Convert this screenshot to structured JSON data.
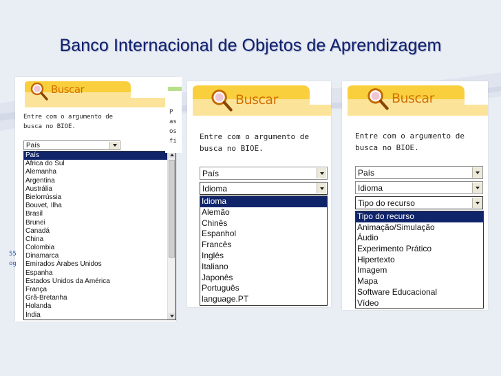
{
  "slide": {
    "title": "Banco Internacional de Objetos de Aprendizagem"
  },
  "colors": {
    "title": "#10206e",
    "buscar": "#d26f00",
    "header_bar": "#f9cf3e",
    "selected": "#10246a"
  },
  "panel1": {
    "buscar": "Buscar",
    "instruction": [
      "Entre com o argumento de",
      "busca no BIOE."
    ],
    "select_value": "País",
    "options": [
      "País",
      "África do Sul",
      "Alemanha",
      "Argentina",
      "Austrália",
      "Bielorrússia",
      "Bouvet, Ilha",
      "Brasil",
      "Brunei",
      "Canadá",
      "China",
      "Colombia",
      "Dinamarca",
      "Emirados Árabes Unidos",
      "Espanha",
      "Estados Unidos da América",
      "França",
      "Grã-Bretanha",
      "Holanda",
      "Índia"
    ],
    "side_fragments": [
      "P",
      "as",
      "os",
      "fi"
    ],
    "left_fragments": [
      "55",
      "og"
    ]
  },
  "panel2": {
    "buscar": "Buscar",
    "instruction": [
      "Entre com o argumento de",
      "busca no BIOE."
    ],
    "select_pais": "País",
    "select_idioma": "Idioma",
    "options": [
      "Idioma",
      "Alemão",
      "Chinês",
      "Espanhol",
      "Francês",
      "Inglês",
      "Italiano",
      "Japonês",
      "Português",
      "language.PT"
    ]
  },
  "panel3": {
    "buscar": "Buscar",
    "instruction": [
      "Entre com o argumento de",
      "busca no BIOE."
    ],
    "select_pais": "País",
    "select_idioma": "Idioma",
    "select_tipo": "Tipo do recurso",
    "options": [
      "Tipo do recurso",
      "Animação/Simulação",
      "Áudio",
      "Experimento Prático",
      "Hipertexto",
      "Imagem",
      "Mapa",
      "Software Educacional",
      "Vídeo"
    ]
  }
}
